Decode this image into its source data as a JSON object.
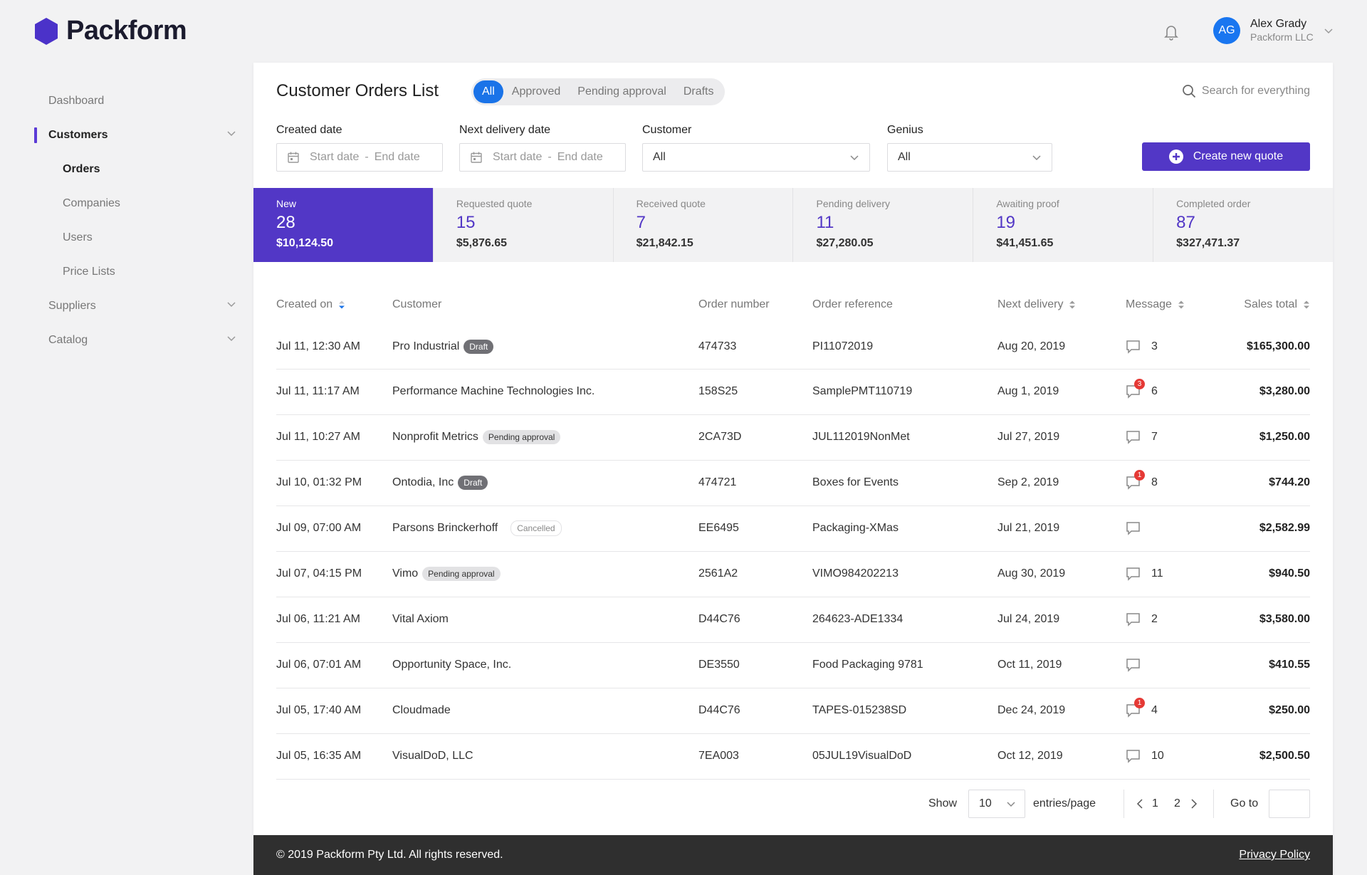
{
  "brand": {
    "name": "Packform"
  },
  "user": {
    "initials": "AG",
    "name": "Alex Grady",
    "company": "Packform LLC"
  },
  "nav": {
    "items": [
      {
        "label": "Dashboard"
      },
      {
        "label": "Customers"
      },
      {
        "label": "Orders"
      },
      {
        "label": "Companies"
      },
      {
        "label": "Users"
      },
      {
        "label": "Price Lists"
      },
      {
        "label": "Suppliers"
      },
      {
        "label": "Catalog"
      }
    ]
  },
  "page": {
    "title": "Customer Orders List",
    "tabs": [
      "All",
      "Approved",
      "Pending approval",
      "Drafts"
    ],
    "search_placeholder": "Search for everything"
  },
  "filters": {
    "created": {
      "label": "Created date",
      "start": "Start date",
      "end": "End date"
    },
    "delivery": {
      "label": "Next delivery date",
      "start": "Start date",
      "end": "End date"
    },
    "customer": {
      "label": "Customer",
      "value": "All"
    },
    "genius": {
      "label": "Genius",
      "value": "All"
    }
  },
  "create_button": "Create new quote",
  "stats": [
    {
      "label": "New",
      "count": "28",
      "amount": "$10,124.50"
    },
    {
      "label": "Requested quote",
      "count": "15",
      "amount": "$5,876.65"
    },
    {
      "label": "Received quote",
      "count": "7",
      "amount": "$21,842.15"
    },
    {
      "label": "Pending delivery",
      "count": "11",
      "amount": "$27,280.05"
    },
    {
      "label": "Awaiting proof",
      "count": "19",
      "amount": "$41,451.65"
    },
    {
      "label": "Completed order",
      "count": "87",
      "amount": "$327,471.37"
    }
  ],
  "table": {
    "headers": [
      "Created on",
      "Customer",
      "Order number",
      "Order reference",
      "Next delivery",
      "Message",
      "Sales total"
    ],
    "rows": [
      {
        "created": "Jul 11, 12:30 AM",
        "customer": "Pro Industrial",
        "badge": "Draft",
        "order": "474733",
        "ref": "PI11072019",
        "delivery": "Aug 20, 2019",
        "unread": "",
        "messages": "3",
        "total": "$165,300.00"
      },
      {
        "created": "Jul 11, 11:17 AM",
        "customer": "Performance Machine Technologies Inc.",
        "badge": "",
        "order": "158S25",
        "ref": "SamplePMT110719",
        "delivery": "Aug 1, 2019",
        "unread": "3",
        "messages": "6",
        "total": "$3,280.00"
      },
      {
        "created": "Jul 11, 10:27 AM",
        "customer": "Nonprofit Metrics",
        "badge": "Pending approval",
        "order": "2CA73D",
        "ref": "JUL112019NonMet",
        "delivery": "Jul 27, 2019",
        "unread": "",
        "messages": "7",
        "total": "$1,250.00"
      },
      {
        "created": "Jul 10, 01:32 PM",
        "customer": "Ontodia, Inc",
        "badge": "Draft",
        "order": "474721",
        "ref": "Boxes for Events",
        "delivery": "Sep 2, 2019",
        "unread": "1",
        "messages": "8",
        "total": "$744.20"
      },
      {
        "created": "Jul 09, 07:00 AM",
        "customer": "Parsons Brinckerhoff",
        "badge": "Cancelled",
        "order": "EE6495",
        "ref": "Packaging-XMas",
        "delivery": "Jul 21, 2019",
        "unread": "",
        "messages": "",
        "total": "$2,582.99"
      },
      {
        "created": "Jul 07, 04:15 PM",
        "customer": "Vimo",
        "badge": "Pending approval",
        "order": "2561A2",
        "ref": "VIMO984202213",
        "delivery": "Aug 30, 2019",
        "unread": "",
        "messages": "11",
        "total": "$940.50"
      },
      {
        "created": "Jul 06, 11:21 AM",
        "customer": "Vital Axiom",
        "badge": "",
        "order": "D44C76",
        "ref": "264623-ADE1334",
        "delivery": "Jul 24, 2019",
        "unread": "",
        "messages": "2",
        "total": "$3,580.00"
      },
      {
        "created": "Jul 06, 07:01 AM",
        "customer": "Opportunity Space, Inc.",
        "badge": "",
        "order": "DE3550",
        "ref": "Food Packaging 9781",
        "delivery": "Oct 11, 2019",
        "unread": "",
        "messages": "",
        "total": "$410.55"
      },
      {
        "created": "Jul 05, 17:40 AM",
        "customer": "Cloudmade",
        "badge": "",
        "order": "D44C76",
        "ref": "TAPES-015238SD",
        "delivery": "Dec 24, 2019",
        "unread": "1",
        "messages": "4",
        "total": "$250.00"
      },
      {
        "created": "Jul 05, 16:35 AM",
        "customer": "VisualDoD, LLC",
        "badge": "",
        "order": "7EA003",
        "ref": "05JUL19VisualDoD",
        "delivery": "Oct 12, 2019",
        "unread": "",
        "messages": "10",
        "total": "$2,500.50"
      }
    ]
  },
  "pager": {
    "show": "Show",
    "per_page": "10",
    "entries": "entries/page",
    "pages": [
      "1",
      "2"
    ],
    "goto": "Go to"
  },
  "footer": {
    "copyright": "© 2019 Packform Pty Ltd. All rights reserved.",
    "privacy": "Privacy Policy"
  },
  "colors": {
    "accent": "#5237c6",
    "tab_active": "#1a73e8",
    "badge_alert": "#e53935",
    "footer": "#2f2f2f",
    "logo": "#4b32c9"
  }
}
